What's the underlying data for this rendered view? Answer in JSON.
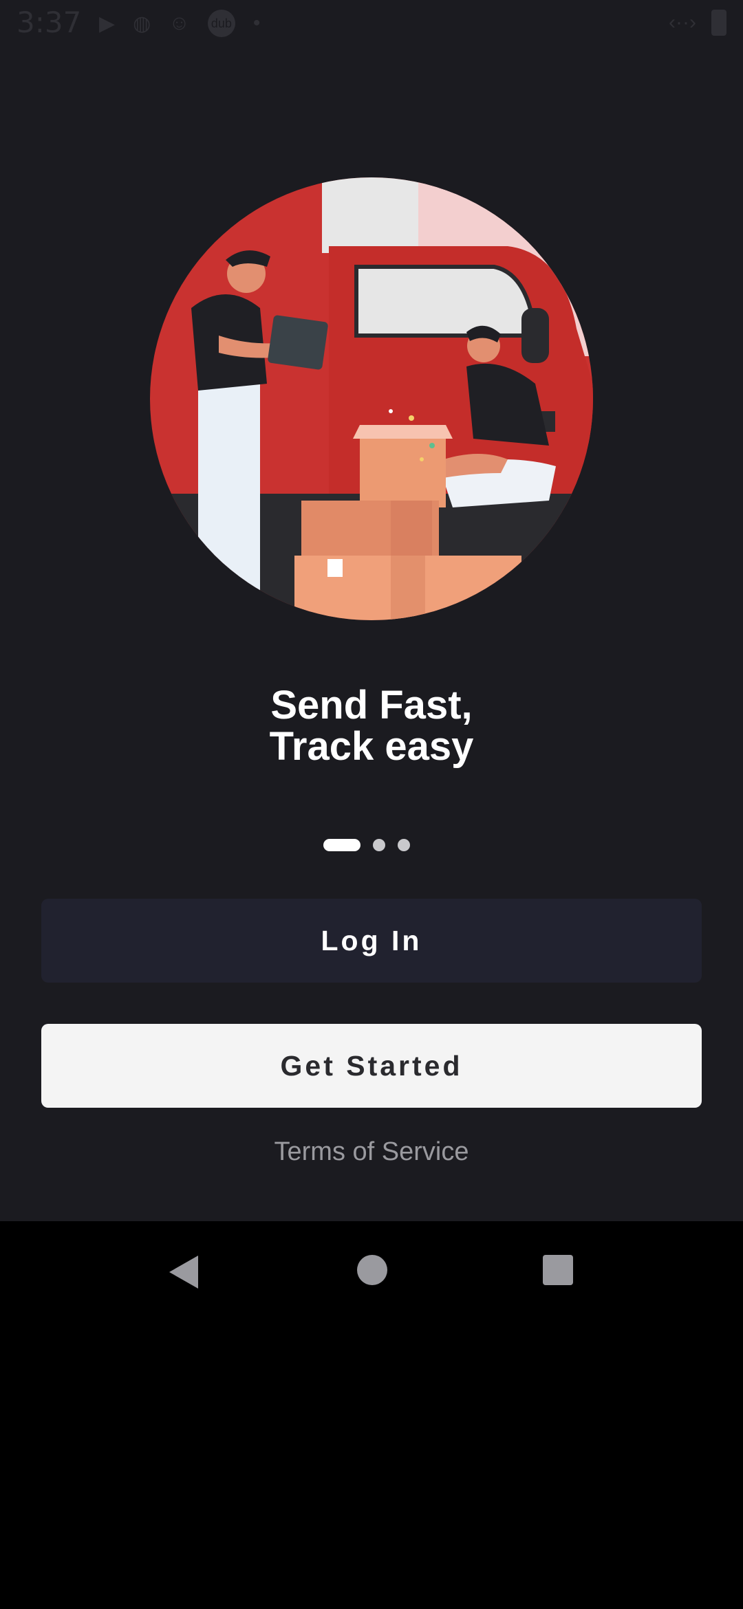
{
  "status_bar": {
    "time": "3:37",
    "icons": [
      "play-icon",
      "game-controller-icon",
      "face-icon",
      "dub-icon",
      "dot-icon"
    ],
    "dub_label": "dub"
  },
  "hero": {
    "image": "delivery-illustration"
  },
  "onboarding": {
    "headline_line1": "Send Fast,",
    "headline_line2": "Track easy",
    "page_count": 3,
    "active_page": 1
  },
  "actions": {
    "login_label": "Log In",
    "get_started_label": "Get Started",
    "terms_label": "Terms of Service"
  },
  "colors": {
    "background": "#1b1b20",
    "login_button": "#21222f",
    "get_started_button": "#f4f4f4",
    "accent_red": "#c93230"
  }
}
